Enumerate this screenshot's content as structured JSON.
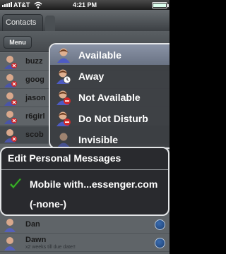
{
  "status_bar": {
    "carrier": "AT&T",
    "time": "4:21 PM"
  },
  "tabs": {
    "contacts_label": "Contacts"
  },
  "toolbar": {
    "menu_label": "Menu"
  },
  "contacts": [
    {
      "name": "buzz",
      "status": "blocked"
    },
    {
      "name": "goog",
      "status": "blocked"
    },
    {
      "name": "jason",
      "status": "blocked"
    },
    {
      "name": "r6girl",
      "status": "blocked"
    },
    {
      "name": "scob",
      "status": "blocked"
    }
  ],
  "bottom_contacts": [
    {
      "name": "Dan",
      "sub": ""
    },
    {
      "name": "Dawn",
      "sub": "x2 weeks till due date!!"
    }
  ],
  "status_menu": {
    "items": [
      {
        "label": "Available",
        "icon": "person-available-icon",
        "selected": true
      },
      {
        "label": "Away",
        "icon": "person-away-icon",
        "selected": false
      },
      {
        "label": "Not Available",
        "icon": "person-not-available-icon",
        "selected": false
      },
      {
        "label": "Do Not Disturb",
        "icon": "person-dnd-icon",
        "selected": false
      },
      {
        "label": "Invisible",
        "icon": "person-invisible-icon",
        "selected": false
      }
    ]
  },
  "personal_messages": {
    "title": "Edit Personal Messages",
    "items": [
      {
        "label": "Mobile with...essenger.com",
        "checked": true
      },
      {
        "label": "(-none-)",
        "checked": false
      }
    ]
  },
  "colors": {
    "accent_check": "#3fae2e",
    "menu_border": "#e2e4e6",
    "selected_row": "#7a8396"
  }
}
